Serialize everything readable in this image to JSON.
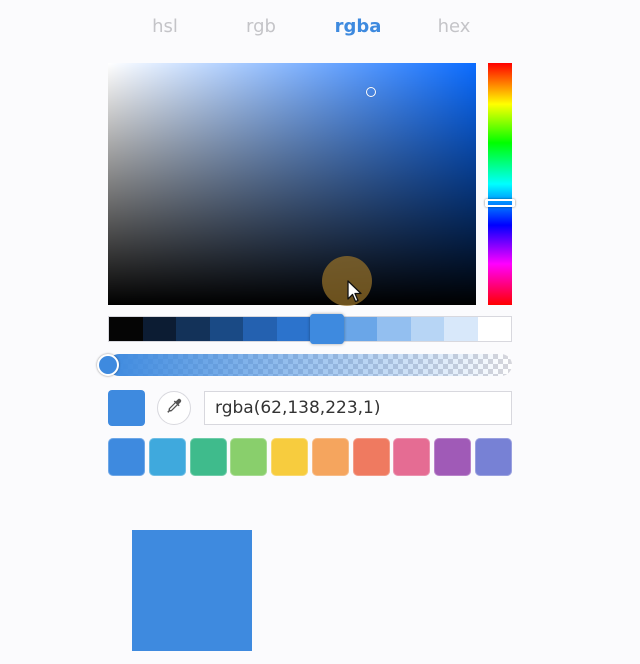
{
  "tabs": [
    {
      "label": "hsl",
      "active": false
    },
    {
      "label": "rgb",
      "active": false
    },
    {
      "label": "rgba",
      "active": true
    },
    {
      "label": "hex",
      "active": false
    }
  ],
  "picker": {
    "hue_color": "#0b6cff",
    "selected_color": "#3e8adf",
    "alpha": 1
  },
  "shades": [
    "#050505",
    "#0c1c33",
    "#133259",
    "#1a4a85",
    "#2461b0",
    "#2c73cc",
    "#3e8adf",
    "#6aa6e8",
    "#93bff0",
    "#b7d5f5",
    "#d8e8fa",
    "#ffffff"
  ],
  "selected_shade_index": 6,
  "color_input": {
    "value": "rgba(62,138,223,1)"
  },
  "presets": [
    "#3e8adf",
    "#3fa9dd",
    "#3fbb8c",
    "#89cf6c",
    "#f7cc3e",
    "#f5a55e",
    "#ef7a60",
    "#e56c93",
    "#a05ab7",
    "#7781d5"
  ],
  "preview": {
    "color": "#3e8adf"
  },
  "icons": {
    "eyedropper": "eyedropper-icon",
    "cursor": "mouse-pointer-icon"
  }
}
